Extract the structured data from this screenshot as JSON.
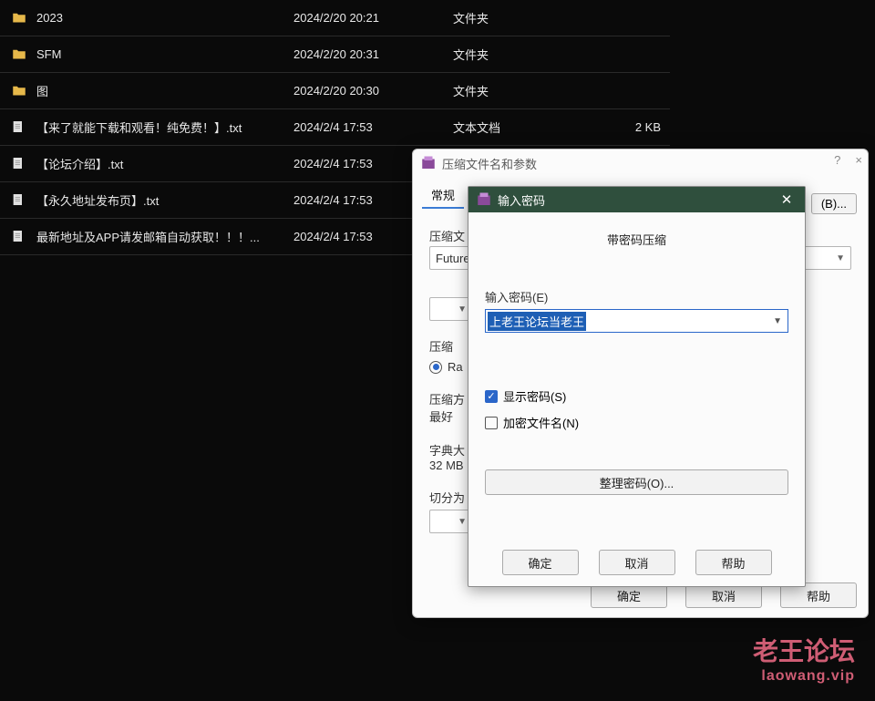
{
  "files": [
    {
      "name": "2023",
      "date": "2024/2/20 20:21",
      "type": "文件夹",
      "size": "",
      "icon": "folder"
    },
    {
      "name": "SFM",
      "date": "2024/2/20 20:31",
      "type": "文件夹",
      "size": "",
      "icon": "folder"
    },
    {
      "name": "图",
      "date": "2024/2/20 20:30",
      "type": "文件夹",
      "size": "",
      "icon": "folder"
    },
    {
      "name": "【来了就能下载和观看！纯免费！】.txt",
      "date": "2024/2/4 17:53",
      "type": "文本文档",
      "size": "2 KB",
      "icon": "file"
    },
    {
      "name": "【论坛介绍】.txt",
      "date": "2024/2/4 17:53",
      "type": "",
      "size": "",
      "icon": "file"
    },
    {
      "name": "【永久地址发布页】.txt",
      "date": "2024/2/4 17:53",
      "type": "",
      "size": "",
      "icon": "file"
    },
    {
      "name": "最新地址及APP请发邮箱自动获取！！！...",
      "date": "2024/2/4 17:53",
      "type": "",
      "size": "",
      "icon": "file"
    }
  ],
  "outerDialog": {
    "title": "压缩文件名和参数",
    "help": "?",
    "close": "×",
    "tab_general": "常规",
    "browse_label": "(B)...",
    "archive_label": "压缩文",
    "archive_value": "Future",
    "format_label": "压缩",
    "format_option": "Ra",
    "method_label": "压缩方",
    "method_line2": "最好",
    "dict_label": "字典大",
    "dict_value": "32 MB",
    "split_label": "切分为",
    "btn_ok": "确定",
    "btn_cancel": "取消",
    "btn_help": "帮助"
  },
  "innerDialog": {
    "title": "输入密码",
    "heading": "带密码压缩",
    "pw_label": "输入密码(E)",
    "pw_value": "上老王论坛当老王",
    "show_pw": "显示密码(S)",
    "enc_names": "加密文件名(N)",
    "organize": "整理密码(O)...",
    "btn_ok": "确定",
    "btn_cancel": "取消",
    "btn_help": "帮助"
  },
  "watermark": {
    "line1": "老王论坛",
    "line2": "laowang.vip"
  }
}
